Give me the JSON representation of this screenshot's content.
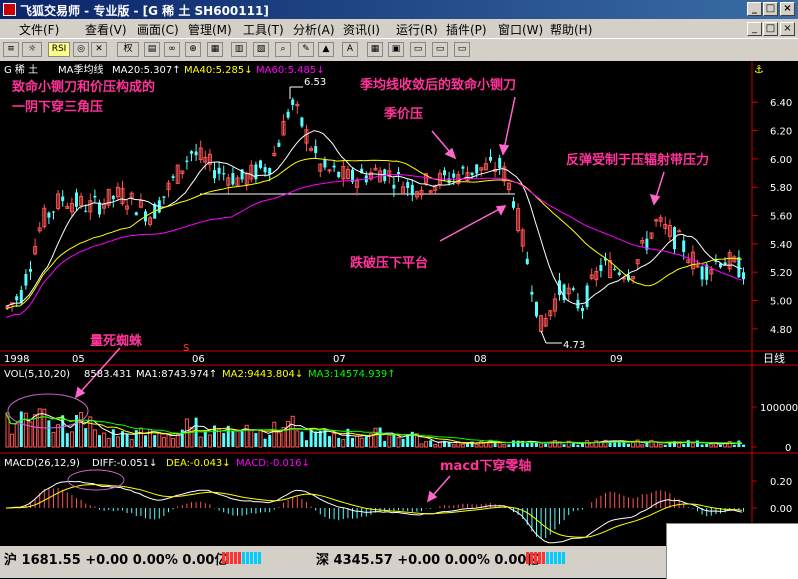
{
  "window": {
    "title": "飞狐交易师 - 专业版 - [G 稀 土 SH600111]",
    "buttons": [
      "_",
      "□",
      "×"
    ]
  },
  "menu": {
    "items": [
      "文件(F)",
      "查看(V)",
      "画面(C)",
      "管理(M)",
      "工具(T)",
      "分析(A)",
      "资讯(I)",
      "运行(R)",
      "插件(P)",
      "窗口(W)",
      "帮助(H)"
    ],
    "mdi_buttons": [
      "_",
      "□",
      "×"
    ]
  },
  "toolbar": {
    "rsi_label": "RSI",
    "right_label": "权"
  },
  "price_panel": {
    "stock_name": "G 稀  土",
    "indicator": "MA季均线",
    "ma20": "MA20:5.307↑",
    "ma40": "MA40:5.285↓",
    "ma60": "MA60:5.485↓",
    "y_ticks": [
      "6.40",
      "6.20",
      "6.00",
      "5.80",
      "5.60",
      "5.40",
      "5.20",
      "5.00",
      "4.80"
    ],
    "high_label": "6.53",
    "low_label": "4.73",
    "x_labels": [
      "1998",
      "05",
      "06",
      "07",
      "08",
      "09"
    ],
    "period": "日线",
    "marker_s": "S"
  },
  "annotations": {
    "a1": "致命小铡刀和价压构成的",
    "a2": "一阴下穿三角压",
    "a3": "季均线收敛后的致命小铡刀",
    "a4": "季价压",
    "a5": "反弹受制于压辐射带压力",
    "a6": "跌破压下平台",
    "a7": "量死蜘蛛",
    "a8": "macd下穿零轴"
  },
  "vol_panel": {
    "header": "VOL(5,10,20)",
    "value": "8583.431",
    "ma1": "MA1:8743.974↑",
    "ma2": "MA2:9443.804↓",
    "ma3": "MA3:14574.939↑",
    "y_ticks": [
      "100000",
      "0"
    ]
  },
  "macd_panel": {
    "header": "MACD(26,12,9)",
    "diff": "DIFF:-0.051↓",
    "dea": "DEA:-0.043↓",
    "macd": "MACD:-0.016↓",
    "y_ticks": [
      "0.20",
      "0.00"
    ]
  },
  "status": {
    "sh": "沪 1681.55 +0.00 0.00% 0.00亿",
    "sz": "深 4345.57 +0.00 0.00% 0.00亿"
  },
  "colors": {
    "up": "#ff5454",
    "down": "#54ffff",
    "ma20": "#ffffff",
    "ma40": "#ffff00",
    "ma60": "#ff00ff",
    "annotation": "#ff3399",
    "axis": "#cc0000"
  },
  "chart_data": {
    "type": "candlestick",
    "ylim": [
      4.7,
      6.55
    ],
    "events": {
      "high": 6.53,
      "low": 4.73
    },
    "ma_current": {
      "ma20": 5.307,
      "ma40": 5.285,
      "ma60": 5.485
    },
    "volume_ma_current": {
      "ma1": 8743.974,
      "ma2": 9443.804,
      "ma3": 14574.939
    },
    "macd_current": {
      "diff": -0.051,
      "dea": -0.043,
      "macd": -0.016
    }
  }
}
